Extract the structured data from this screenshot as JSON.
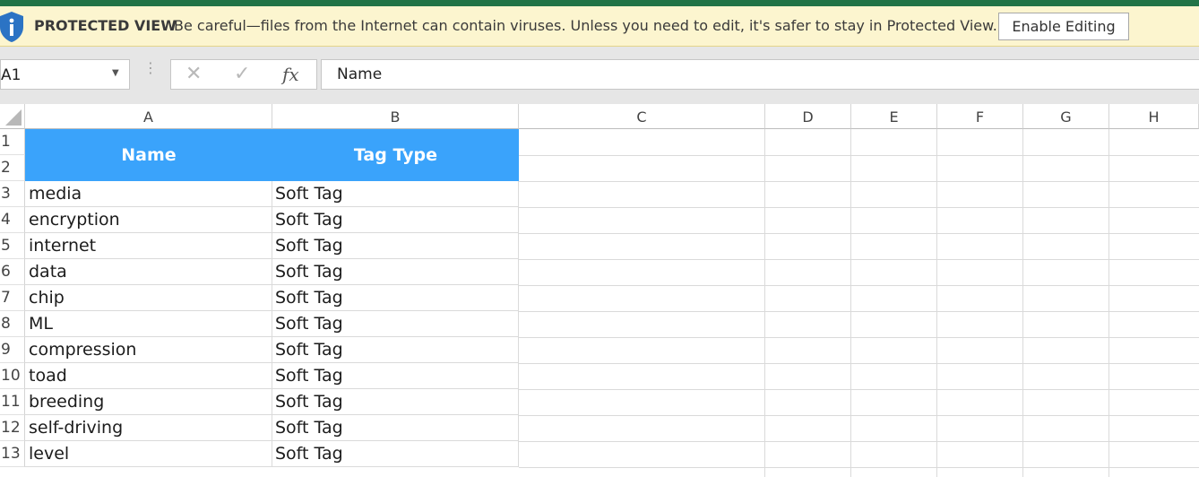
{
  "protected_view": {
    "title": "PROTECTED VIEW",
    "message": "Be careful—files from the Internet can contain viruses. Unless you need to edit, it's safer to stay in Protected View.",
    "enable_button": "Enable Editing"
  },
  "formula_bar": {
    "name_box": "A1",
    "fx_label": "fx",
    "cancel_glyph": "✕",
    "enter_glyph": "✓",
    "value": "Name"
  },
  "columns": [
    "A",
    "B",
    "C",
    "D",
    "E",
    "F",
    "G",
    "H"
  ],
  "header_row": {
    "col_a": "Name",
    "col_b": "Tag Type"
  },
  "row_numbers": [
    "1",
    "2",
    "3",
    "4",
    "5",
    "6",
    "7",
    "8",
    "9",
    "10",
    "11",
    "12",
    "13"
  ],
  "rows": [
    {
      "name": "media",
      "tag": "Soft Tag"
    },
    {
      "name": "encryption",
      "tag": "Soft Tag"
    },
    {
      "name": "internet",
      "tag": "Soft Tag"
    },
    {
      "name": "data",
      "tag": "Soft Tag"
    },
    {
      "name": "chip",
      "tag": "Soft Tag"
    },
    {
      "name": "ML",
      "tag": "Soft Tag"
    },
    {
      "name": "compression",
      "tag": "Soft Tag"
    },
    {
      "name": "toad",
      "tag": "Soft Tag"
    },
    {
      "name": "breeding",
      "tag": "Soft Tag"
    },
    {
      "name": "self-driving",
      "tag": "Soft Tag"
    },
    {
      "name": "level",
      "tag": "Soft Tag"
    }
  ],
  "colors": {
    "header_fill": "#3aa3fb",
    "message_bar": "#fcf5cf",
    "accent": "#217346",
    "info_icon": "#2b73c4"
  },
  "icons": {
    "info": "info-shield-icon",
    "name_box_dropdown": "chevron-down-icon"
  }
}
